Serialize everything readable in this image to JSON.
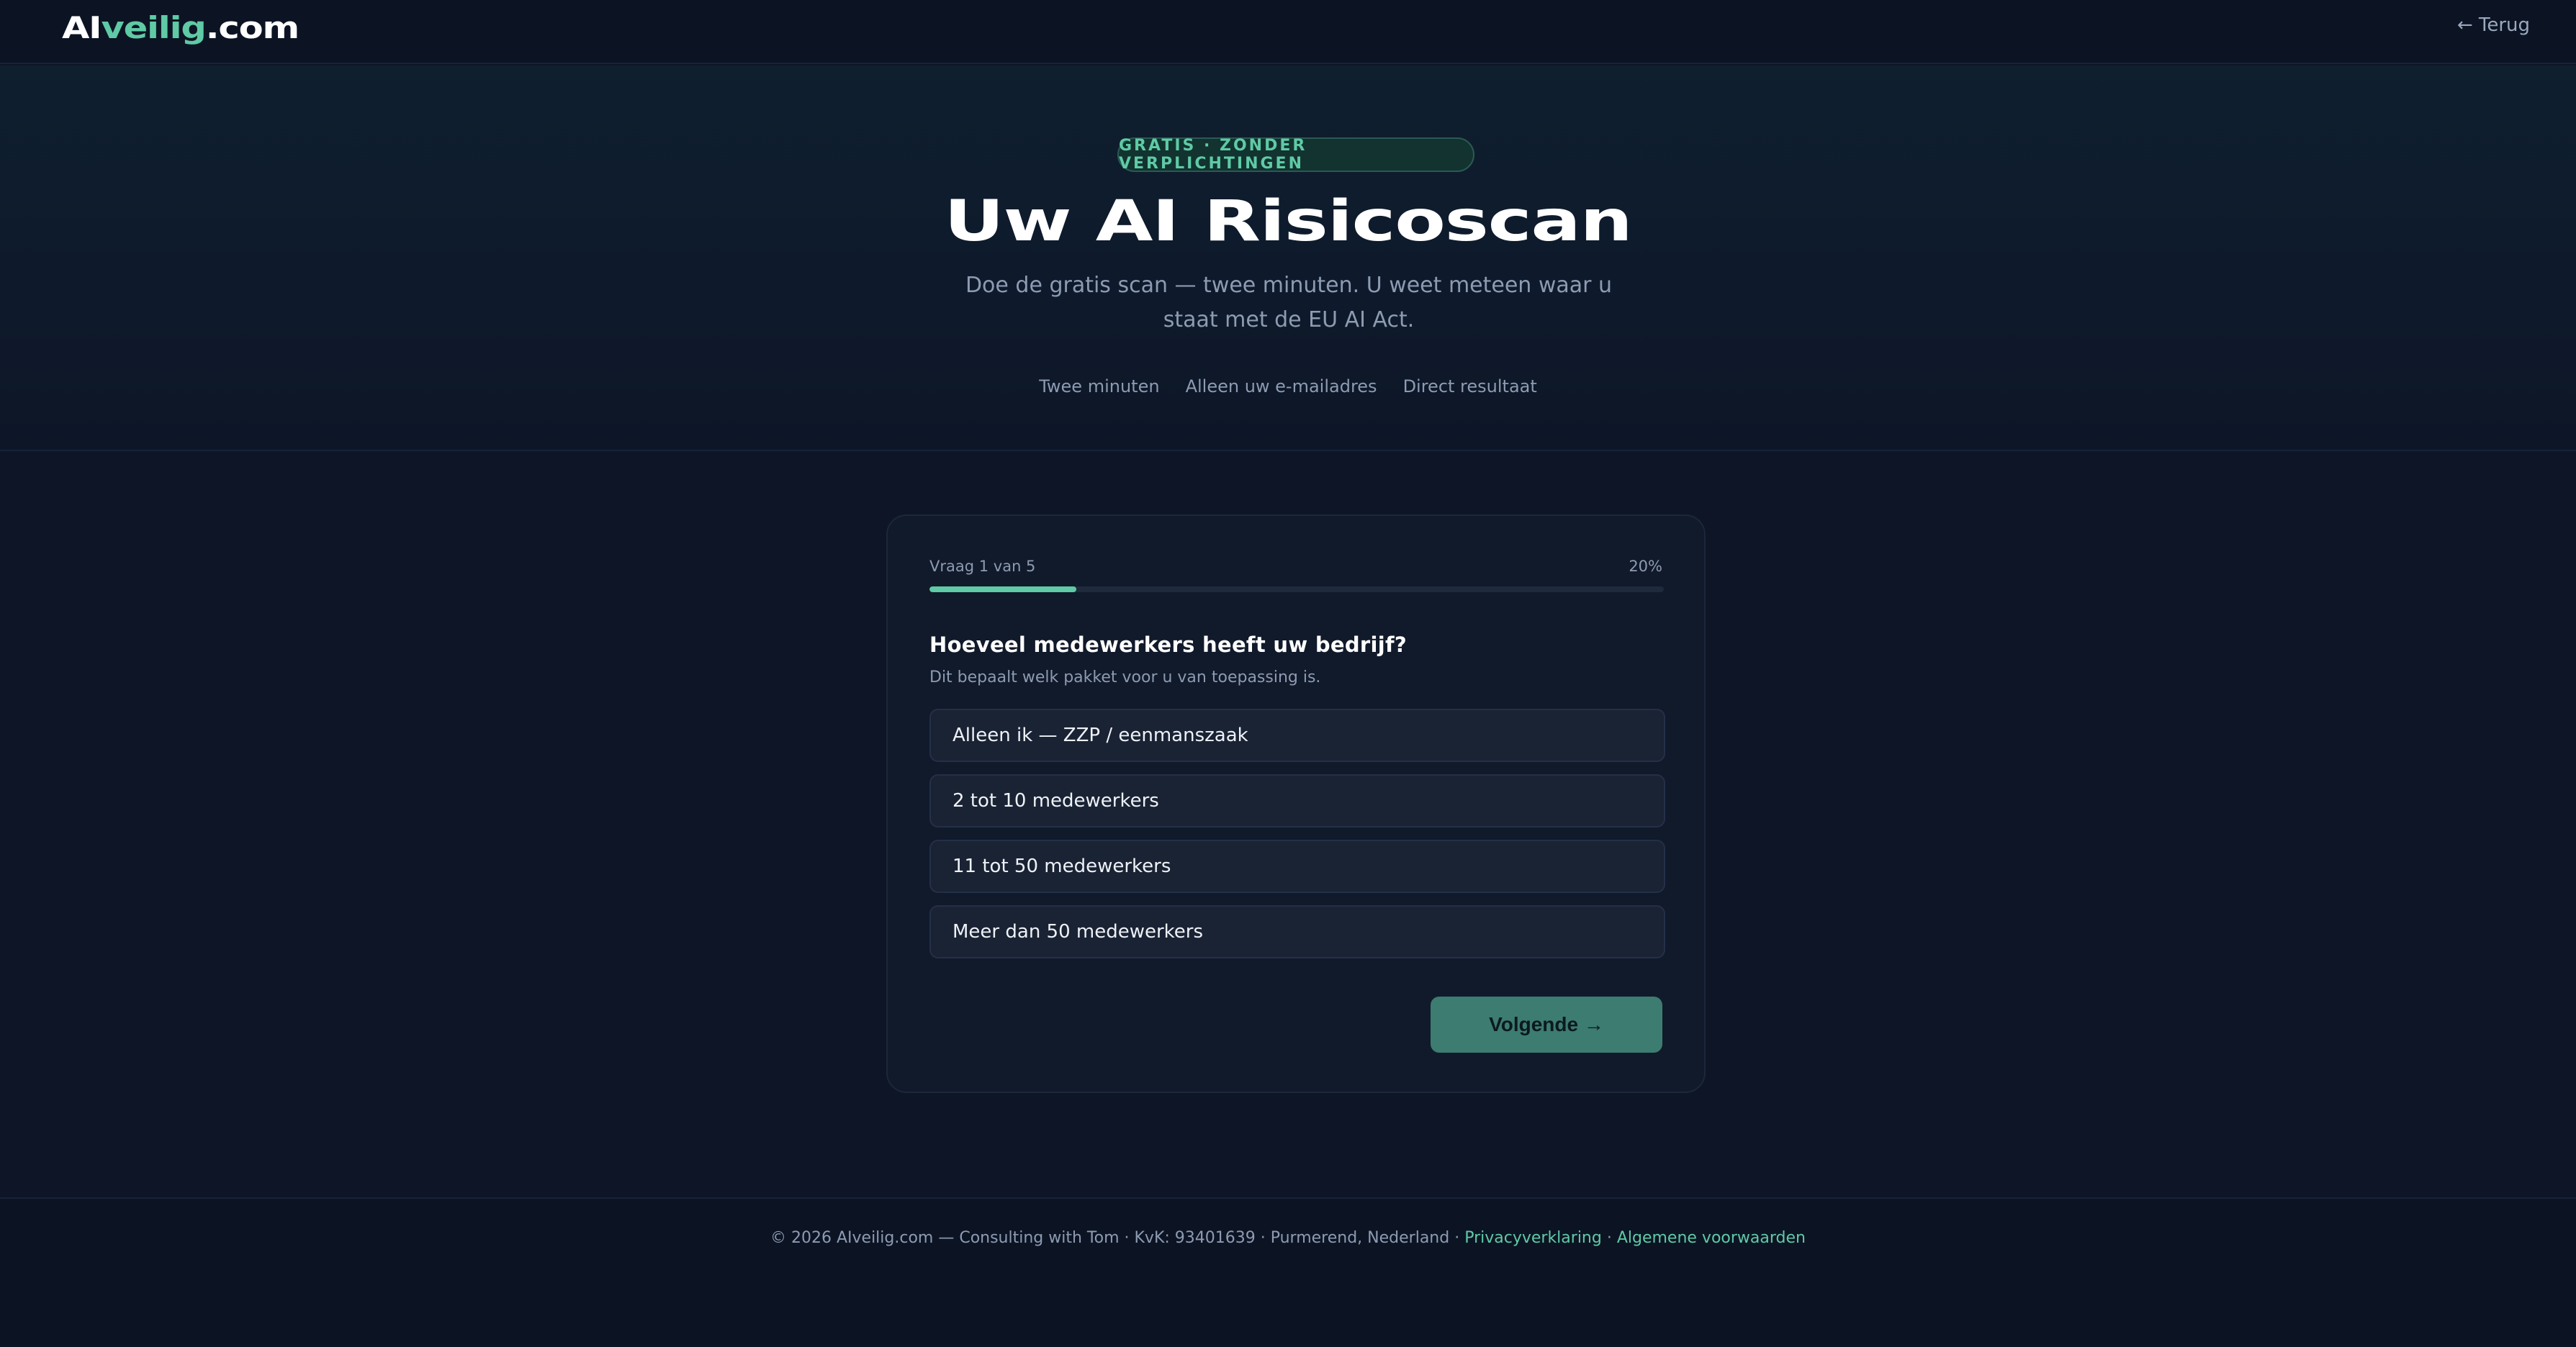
{
  "header": {
    "logo_part1": "AI",
    "logo_part2": "veilig",
    "logo_part3": ".com",
    "back_label": "← Terug"
  },
  "hero": {
    "badge": "GRATIS · ZONDER VERPLICHTINGEN",
    "title": "Uw AI Risicoscan",
    "subtitle": "Doe de gratis scan — twee minuten. U weet meteen waar u staat met de EU AI Act.",
    "features": [
      "Twee minuten",
      "Alleen uw e-mailadres",
      "Direct resultaat"
    ]
  },
  "quiz": {
    "progress_label": "Vraag 1 van 5",
    "progress_percent_label": "20%",
    "progress_fraction": 0.2,
    "question": "Hoeveel medewerkers heeft uw bedrijf?",
    "hint": "Dit bepaalt welk pakket voor u van toepassing is.",
    "options": [
      "Alleen ik — ZZP / eenmanszaak",
      "2 tot 10 medewerkers",
      "11 tot 50 medewerkers",
      "Meer dan 50 medewerkers"
    ],
    "next_label": "Volgende →"
  },
  "footer": {
    "text": "© 2026 AIveilig.com — Consulting with Tom · KvK: 93401639 · Purmerend, Nederland · ",
    "privacy_link": "Privacyverklaring",
    "separator": " · ",
    "terms_link": "Algemene voorwaarden"
  },
  "colors": {
    "accent": "#5fcaa5",
    "background": "#0d1526",
    "card": "#111a2b",
    "button": "#3d7c70"
  }
}
